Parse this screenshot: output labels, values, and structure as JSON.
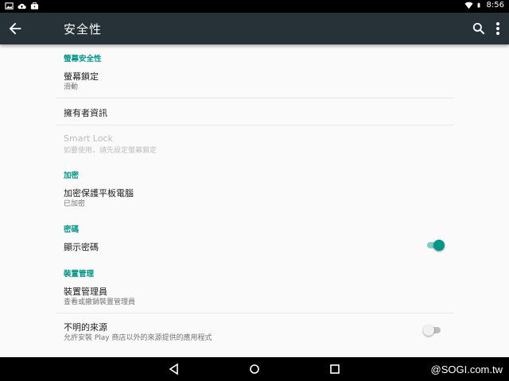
{
  "status_bar": {
    "time": "8:56",
    "left_icons": [
      "image-icon",
      "cloud-upload-icon",
      "briefcase-icon"
    ],
    "right_icons": [
      "wifi-icon",
      "battery-icon"
    ]
  },
  "toolbar": {
    "title": "安全性",
    "back_icon": "arrow-back-icon",
    "search_icon": "search-icon",
    "more_icon": "more-vert-icon"
  },
  "sections": {
    "screen_security": {
      "header": "螢幕安全性",
      "screen_lock": {
        "title": "螢幕鎖定",
        "summary": "滑動"
      },
      "owner_info": {
        "title": "擁有者資訊"
      },
      "smart_lock": {
        "title": "Smart Lock",
        "summary": "如要使用，請先設定螢幕鎖定"
      }
    },
    "encryption": {
      "header": "加密",
      "encrypt_tablet": {
        "title": "加密保護平板電腦",
        "summary": "已加密"
      }
    },
    "passwords": {
      "header": "密碼",
      "show_password": {
        "title": "顯示密碼",
        "enabled": true
      }
    },
    "device_admin": {
      "header": "裝置管理",
      "device_administrators": {
        "title": "裝置管理員",
        "summary": "查看或撤銷裝置管理員"
      },
      "unknown_sources": {
        "title": "不明的來源",
        "summary": "允許安裝 Play 商店以外的來源提供的應用程式",
        "enabled": false
      }
    }
  },
  "nav_bar": {
    "back_icon": "nav-back-icon",
    "home_icon": "nav-home-icon",
    "recents_icon": "nav-recents-icon"
  },
  "watermark": "@SOGI.com.tw",
  "colors": {
    "accent": "#009688",
    "toolbar": "#263238",
    "background": "#fafafa"
  }
}
